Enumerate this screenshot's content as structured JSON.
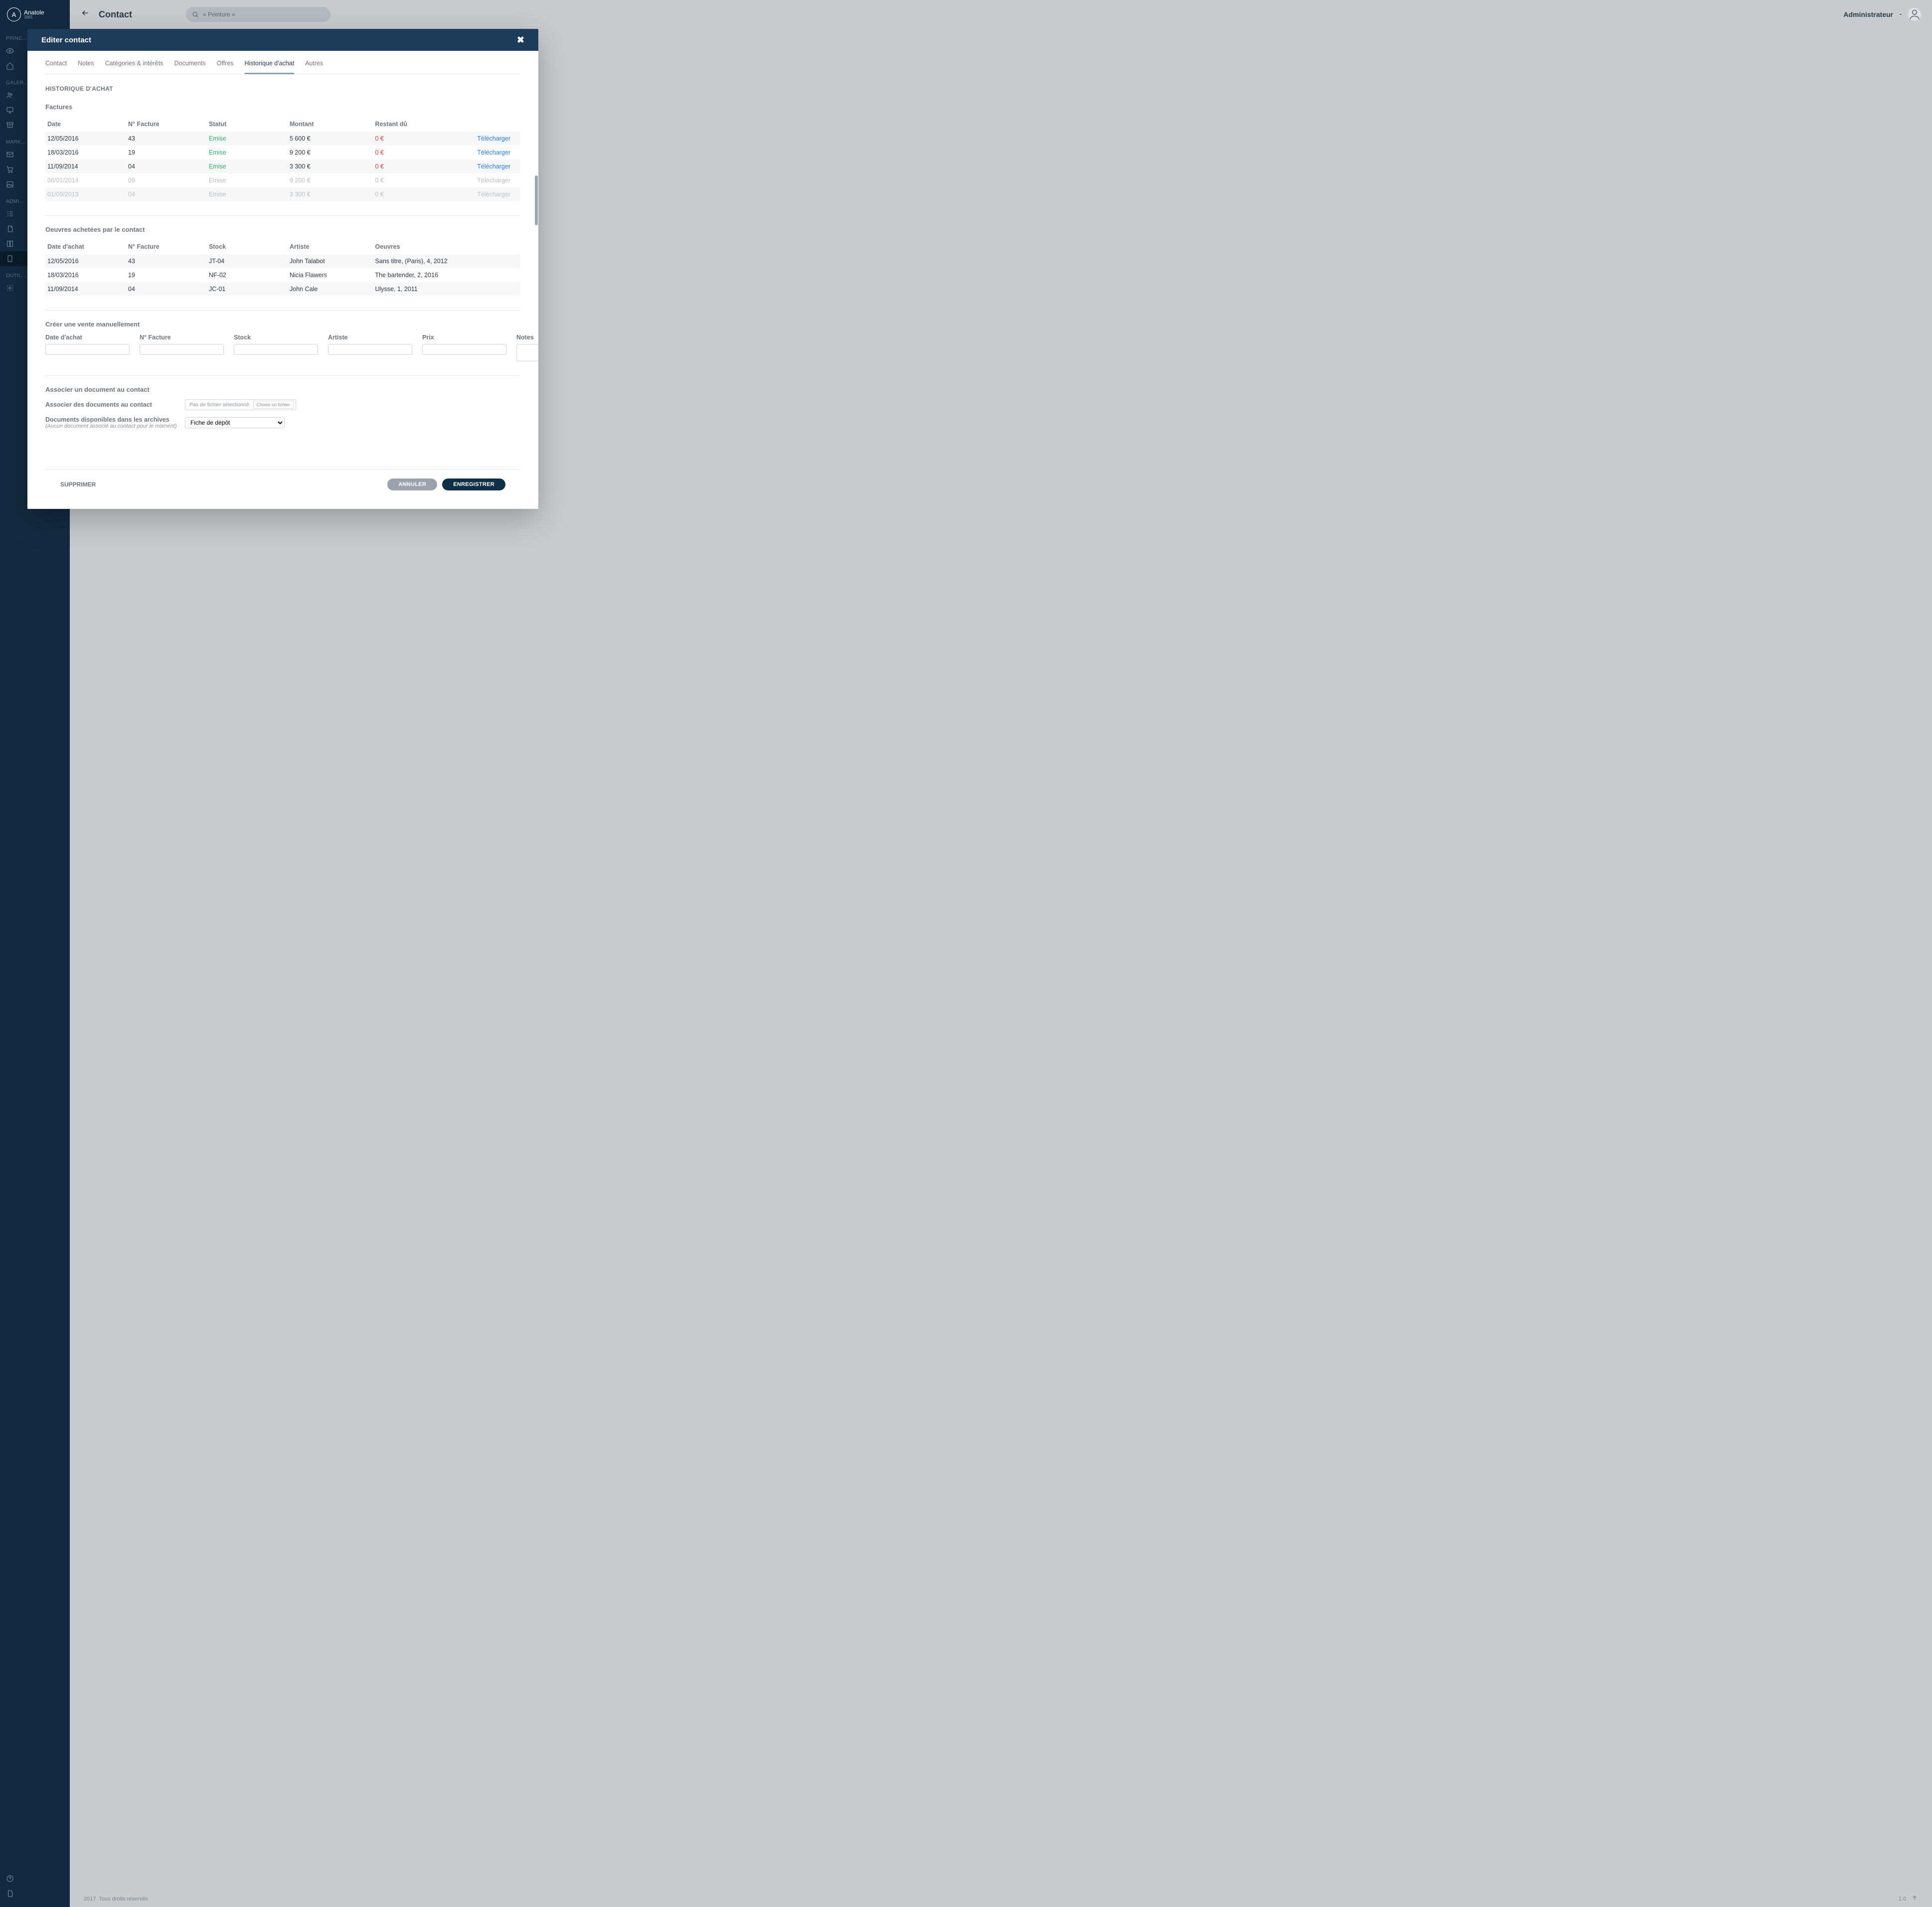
{
  "brand": {
    "letter": "A",
    "name": "Anatole",
    "sub": "1681"
  },
  "sidebar": {
    "groups": [
      "PRINC…",
      "GALER…",
      "MARK…",
      "ADMI…",
      "OUTIL…"
    ]
  },
  "topbar": {
    "title": "Contact",
    "search_value": "« Peinture »",
    "user_label": "Administrateur"
  },
  "modal": {
    "title": "Editer contact",
    "tabs": [
      "Contact",
      "Notes",
      "Catégories & intérêts",
      "Documents",
      "Offres",
      "Historique d'achat",
      "Autres"
    ],
    "active_tab_index": 5,
    "section_heading": "HISTORIQUE D'ACHAT",
    "invoices": {
      "title": "Factures",
      "cols": [
        "Date",
        "N° Facture",
        "Statut",
        "Montant",
        "Restant dû"
      ],
      "action_label": "Télécharger",
      "rows": [
        {
          "date": "12/05/2016",
          "num": "43",
          "status": "Emise",
          "amount": "5 600 €",
          "due": "0 €",
          "faded": false
        },
        {
          "date": "18/03/2016",
          "num": "19",
          "status": "Emise",
          "amount": "9 200 €",
          "due": "0 €",
          "faded": false
        },
        {
          "date": "11/09/2014",
          "num": "04",
          "status": "Emise",
          "amount": "3 300 €",
          "due": "0 €",
          "faded": false
        },
        {
          "date": "08/01/2014",
          "num": "09",
          "status": "Emise",
          "amount": "9 200 €",
          "due": "0 €",
          "faded": true
        },
        {
          "date": "01/09/2013",
          "num": "04",
          "status": "Emise",
          "amount": "3 300 €",
          "due": "0 €",
          "faded": true
        }
      ]
    },
    "works": {
      "title": "Oeuvres achetées par le contact",
      "cols": [
        "Date d'achat",
        "N° Facture",
        "Stock",
        "Artiste",
        "Oeuvres"
      ],
      "rows": [
        {
          "date": "12/05/2016",
          "num": "43",
          "stock": "JT-04",
          "artist": "John Talabot",
          "work": "Sans titre, (Paris), 4, 2012"
        },
        {
          "date": "18/03/2016",
          "num": "19",
          "stock": "NF-02",
          "artist": "Nicia Flawers",
          "work": "The bartender, 2, 2016"
        },
        {
          "date": "11/09/2014",
          "num": "04",
          "stock": "JC-01",
          "artist": "John Cale",
          "work": "Ulysse, 1, 2011"
        }
      ]
    },
    "manual_sale": {
      "title": "Créer une vente manuellement",
      "fields": [
        "Date d'achat",
        "N° Facture",
        "Stock",
        "Artiste",
        "Prix",
        "Notes"
      ]
    },
    "documents": {
      "title": "Associer un document au contact",
      "assoc_label": "Associer des documents au contact",
      "file_placeholder": "Pas de fichier sélectionné",
      "file_btn": "Choisir un fichier",
      "archive_label": "Documents disponibles dans les archives",
      "archive_hint": "(Aucun document associé au contact pour le moment)",
      "select_value": "Fiche de dépôt"
    },
    "footer": {
      "delete": "SUPPRIMER",
      "cancel": "ANNULER",
      "save": "ENREGISTRER"
    }
  },
  "footer": {
    "copyright": "2017. Tous droits réservés",
    "version": "1.0"
  }
}
